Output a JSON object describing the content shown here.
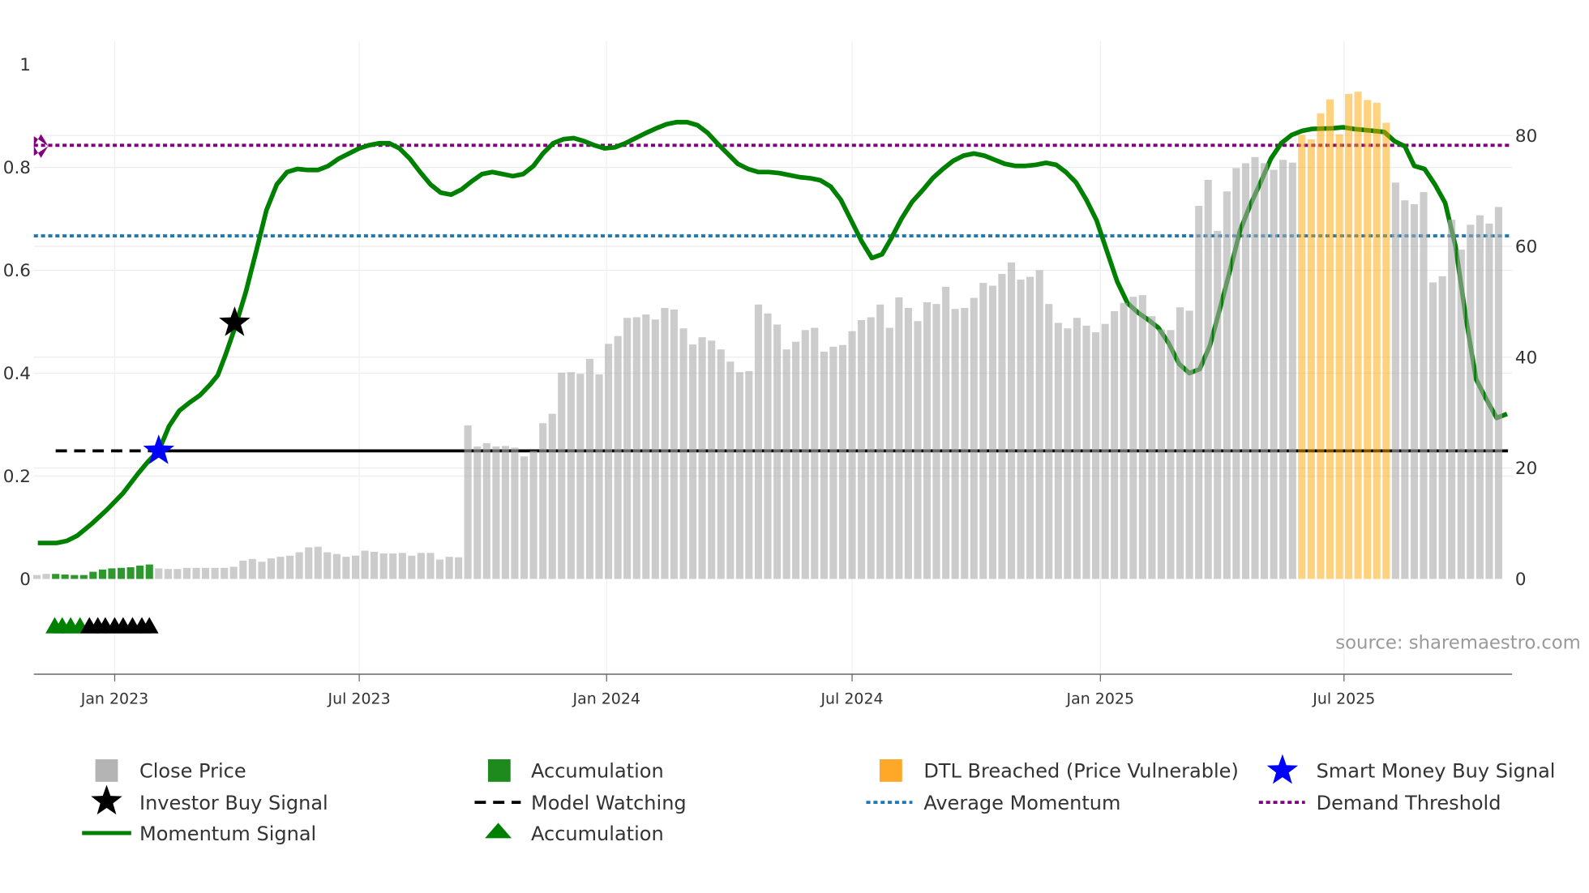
{
  "chart_data": {
    "type": "bar",
    "title": "",
    "xlabel": "",
    "ylabel_left": "",
    "ylabel_right": "",
    "x_unit": "weeks since start of series",
    "ylim_left": [
      -0.185,
      1.05
    ],
    "ylim_right": [
      -17.2,
      97
    ],
    "left_ticks": [
      {
        "v": 0,
        "label": "0"
      },
      {
        "v": 0.2,
        "label": "0.2"
      },
      {
        "v": 0.4,
        "label": "0.4"
      },
      {
        "v": 0.6,
        "label": "0.6"
      },
      {
        "v": 0.8,
        "label": "0.8"
      },
      {
        "v": 1,
        "label": "1"
      }
    ],
    "right_ticks": [
      {
        "v": 0,
        "label": "0"
      },
      {
        "v": 20,
        "label": "20"
      },
      {
        "v": 40,
        "label": "40"
      },
      {
        "v": 60,
        "label": "60"
      },
      {
        "v": 80,
        "label": "80"
      }
    ],
    "x_ticks": [
      {
        "x": 8.3,
        "label": "Jan 2023"
      },
      {
        "x": 34.4,
        "label": "Jul 2023"
      },
      {
        "x": 60.8,
        "label": "Jan 2024"
      },
      {
        "x": 87.0,
        "label": "Jul 2024"
      },
      {
        "x": 113.5,
        "label": "Jan 2025"
      },
      {
        "x": 139.5,
        "label": "Jul 2025"
      }
    ],
    "grid": true,
    "close_price": [
      0.7,
      0.9,
      0.9,
      0.8,
      0.7,
      0.7,
      1.3,
      1.7,
      1.9,
      2.0,
      2.1,
      2.4,
      2.6,
      1.9,
      1.8,
      1.8,
      2.0,
      2.0,
      2.0,
      2.0,
      2.0,
      2.2,
      3.3,
      3.6,
      3.1,
      3.7,
      4.0,
      4.2,
      4.8,
      5.7,
      5.8,
      4.8,
      4.5,
      4.0,
      4.2,
      5.1,
      4.9,
      4.6,
      4.6,
      4.7,
      4.2,
      4.7,
      4.7,
      3.5,
      4.0,
      3.9,
      27.7,
      23.9,
      24.5,
      23.9,
      24.0,
      23.7,
      22.1,
      23.1,
      28.1,
      29.8,
      37.2,
      37.3,
      37.0,
      39.7,
      36.9,
      42.4,
      43.8,
      47.1,
      47.2,
      47.7,
      46.8,
      48.9,
      48.6,
      45.2,
      42.3,
      43.6,
      43.0,
      41.4,
      39.2,
      37.3,
      37.5,
      49.5,
      47.9,
      45.9,
      41.4,
      42.8,
      44.9,
      45.3,
      41.0,
      41.9,
      42.2,
      44.7,
      46.7,
      47.2,
      49.5,
      45.3,
      50.8,
      48.9,
      46.5,
      49.9,
      49.6,
      52.7,
      48.7,
      48.9,
      50.7,
      53.4,
      52.9,
      55.0,
      57.1,
      54.0,
      54.5,
      55.7,
      49.6,
      46.2,
      45.2,
      47.1,
      45.7,
      44.5,
      46.0,
      48.3,
      49.8,
      50.9,
      51.2,
      47.4,
      45.0,
      44.9,
      49.0,
      48.4,
      67.3,
      72.0,
      62.8,
      69.9,
      74.1,
      75.0,
      76.1,
      75.0,
      73.8,
      75.6,
      75.1,
      80.1,
      79.3,
      84.0,
      86.5,
      80.2,
      87.5,
      87.9,
      86.4,
      85.9,
      82.3,
      71.5,
      68.3,
      67.6,
      69.8,
      53.5,
      54.6,
      64.8,
      59.4,
      63.9,
      65.6,
      64.1,
      67.1
    ],
    "accumulation_bar_range": [
      2,
      12
    ],
    "dtl_breached_bar_range": [
      135,
      144
    ],
    "momentum_week": [
      0.1,
      2.1,
      3.2,
      4.3,
      5.9,
      7.5,
      9.2,
      10.8,
      11.9,
      13.0,
      14.1,
      15.2,
      16.3,
      17.4,
      18.5,
      19.3,
      20.1,
      21.2,
      22.3,
      23.4,
      24.5,
      25.6,
      26.7,
      27.8,
      28.9,
      30.0,
      31.1,
      32.2,
      33.3,
      34.4,
      35.4,
      36.5,
      37.6,
      38.7,
      39.8,
      40.9,
      42.0,
      43.1,
      44.2,
      45.3,
      46.4,
      47.5,
      48.6,
      49.7,
      50.8,
      51.9,
      53.0,
      54.0,
      55.1,
      56.2,
      57.3,
      58.4,
      59.5,
      60.6,
      61.7,
      62.8,
      63.9,
      65.0,
      66.1,
      67.2,
      68.3,
      69.4,
      70.5,
      71.6,
      72.6,
      73.7,
      74.8,
      75.9,
      77.0,
      78.1,
      79.2,
      80.3,
      81.4,
      82.5,
      83.6,
      84.7,
      85.8,
      86.9,
      88.0,
      89.1,
      90.2,
      91.2,
      92.3,
      93.4,
      94.5,
      95.6,
      96.7,
      97.8,
      98.9,
      100.0,
      101.1,
      102.2,
      103.3,
      104.4,
      105.5,
      106.6,
      107.7,
      108.8,
      109.8,
      110.9,
      112.0,
      113.1,
      114.2,
      115.3,
      116.4,
      117.5,
      118.6,
      119.7,
      120.8,
      121.9,
      123.0,
      124.1,
      125.2,
      126.3,
      127.4,
      128.4,
      129.5,
      130.6,
      131.7,
      132.8,
      133.9,
      135.0,
      136.1,
      138.3,
      139.4,
      140.5,
      142.7,
      143.8,
      144.9,
      146.0,
      147.0,
      148.1,
      149.2,
      150.3,
      151.4,
      152.5,
      153.6,
      154.7,
      155.8,
      156.9
    ],
    "momentum": [
      0.07,
      0.07,
      0.074,
      0.084,
      0.108,
      0.135,
      0.167,
      0.205,
      0.229,
      0.249,
      0.297,
      0.327,
      0.343,
      0.357,
      0.378,
      0.396,
      0.434,
      0.492,
      0.558,
      0.637,
      0.717,
      0.767,
      0.791,
      0.797,
      0.795,
      0.795,
      0.803,
      0.817,
      0.827,
      0.837,
      0.843,
      0.847,
      0.847,
      0.837,
      0.817,
      0.791,
      0.767,
      0.751,
      0.747,
      0.757,
      0.773,
      0.787,
      0.791,
      0.787,
      0.783,
      0.787,
      0.803,
      0.827,
      0.847,
      0.855,
      0.857,
      0.851,
      0.843,
      0.837,
      0.839,
      0.847,
      0.857,
      0.867,
      0.876,
      0.884,
      0.888,
      0.888,
      0.882,
      0.867,
      0.847,
      0.827,
      0.807,
      0.797,
      0.791,
      0.791,
      0.789,
      0.785,
      0.781,
      0.779,
      0.775,
      0.763,
      0.737,
      0.697,
      0.657,
      0.624,
      0.631,
      0.663,
      0.701,
      0.733,
      0.755,
      0.779,
      0.797,
      0.813,
      0.823,
      0.827,
      0.823,
      0.815,
      0.807,
      0.803,
      0.803,
      0.805,
      0.809,
      0.805,
      0.791,
      0.771,
      0.737,
      0.697,
      0.637,
      0.578,
      0.536,
      0.518,
      0.504,
      0.488,
      0.458,
      0.418,
      0.4,
      0.408,
      0.454,
      0.528,
      0.604,
      0.677,
      0.727,
      0.771,
      0.817,
      0.847,
      0.863,
      0.871,
      0.875,
      0.876,
      0.878,
      0.875,
      0.871,
      0.869,
      0.851,
      0.841,
      0.803,
      0.797,
      0.767,
      0.731,
      0.647,
      0.508,
      0.388,
      0.349,
      0.313,
      0.321
    ],
    "model_watching_level": 0.249,
    "model_watching_start_week": 2.0,
    "model_watching_solid_from_week": 12.0,
    "average_momentum": 0.667,
    "demand_threshold": 0.843,
    "smart_money_buy_signal": {
      "week": 13.0,
      "value": 0.249
    },
    "investor_buy_signal": {
      "week": 21.1,
      "value": 0.498
    },
    "accumulation_triangles_green": [
      1.9,
      2.7,
      3.6,
      4.6
    ],
    "accumulation_triangles_black": [
      5.6,
      6.5,
      7.3,
      8.3,
      9.2,
      10.2,
      11.2,
      12.0
    ],
    "triangle_level": -0.092,
    "colors": {
      "close_price": "#cccccc",
      "accumulation": "#1e8a1e",
      "dtl": "#ffa726",
      "momentum": "#008000",
      "smart_money": "#0000ff",
      "investor": "#000000",
      "average": "#1f77b4",
      "demand": "#800080"
    },
    "legend_placement": "bottom",
    "source": "source: sharemaestro.com",
    "legend": [
      {
        "label": "Close Price"
      },
      {
        "label": "Accumulation"
      },
      {
        "label": "DTL Breached (Price Vulnerable)"
      },
      {
        "label": "Smart Money Buy Signal"
      },
      {
        "label": "Investor Buy Signal"
      },
      {
        "label": "Model Watching"
      },
      {
        "label": "Average Momentum"
      },
      {
        "label": "Demand Threshold"
      },
      {
        "label": "Momentum Signal"
      },
      {
        "label": "Accumulation"
      }
    ]
  }
}
